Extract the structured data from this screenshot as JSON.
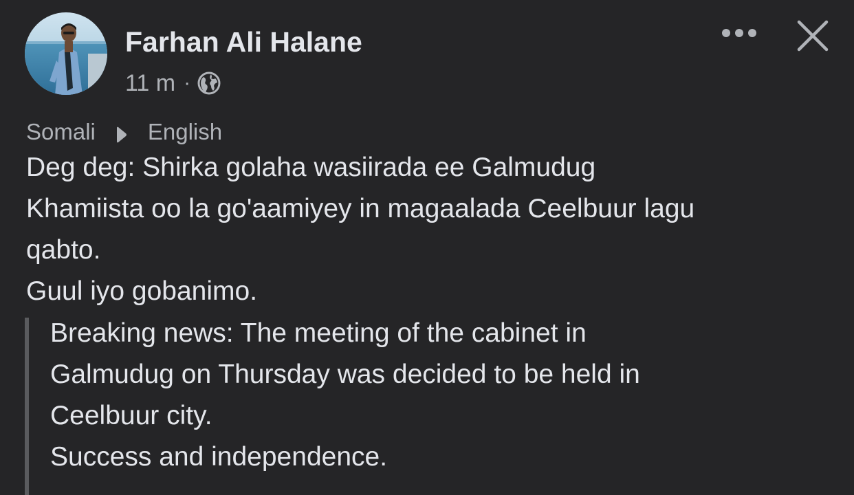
{
  "post": {
    "author": "Farhan Ali Halane",
    "time": "11 m",
    "separator": "·",
    "privacy_icon": "globe-icon",
    "more_icon": "more-horizontal-icon",
    "close_icon": "close-icon"
  },
  "translation_bar": {
    "source_language": "Somali",
    "arrow_icon": "play-arrow-icon",
    "target_language": "English"
  },
  "original_text": {
    "lines": [
      "Deg deg: Shirka golaha wasiirada ee Galmudug",
      "Khamiista oo la go'aamiyey in magaalada Ceelbuur lagu",
      "qabto.",
      "Guul iyo gobanimo."
    ]
  },
  "translated_text": {
    "lines": [
      "Breaking news: The meeting of the cabinet in",
      "Galmudug on Thursday was decided to be held in",
      "Ceelbuur city.",
      "Success and independence."
    ]
  },
  "colors": {
    "background": "#252527",
    "primary_text": "#e4e6eb",
    "secondary_text": "#b0b3b8",
    "quote_bar": "#5a5b5e"
  }
}
